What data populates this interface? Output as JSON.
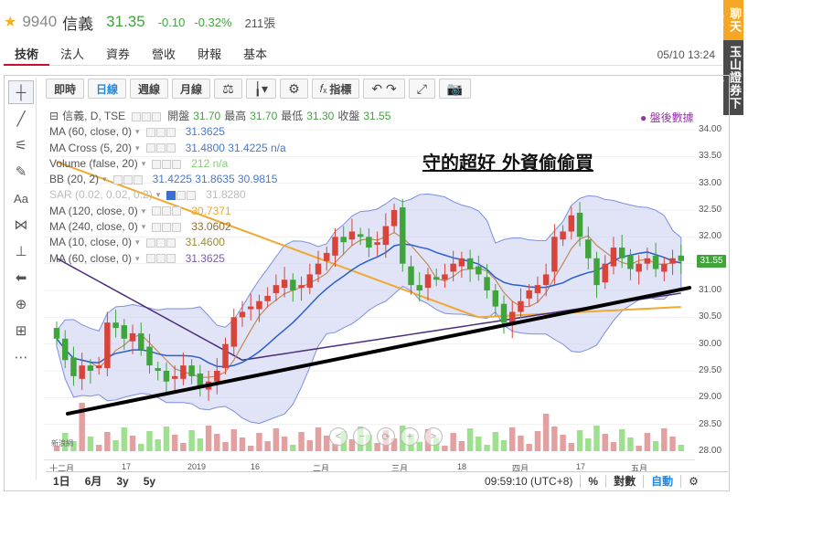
{
  "header": {
    "code": "9940",
    "name": "信義",
    "price": "31.35",
    "change": "-0.10",
    "change_pct": "-0.32%",
    "volume": "211張"
  },
  "tabs": [
    "技術",
    "法人",
    "資券",
    "營收",
    "財報",
    "基本"
  ],
  "active_tab": 0,
  "datetime": "05/10 13:24",
  "side_panel": {
    "chat": "聊天室",
    "broker": "玉山證券下單"
  },
  "toolbar": {
    "buttons": [
      "即時",
      "日線",
      "週線",
      "月線"
    ],
    "active": "日線",
    "indicators_label": "指標"
  },
  "legend": {
    "main": {
      "title": "信義, D, TSE",
      "open_label": "開盤",
      "open": "31.70",
      "high_label": "最高",
      "high": "31.70",
      "low_label": "最低",
      "low": "31.30",
      "close_label": "收盤",
      "close": "31.55"
    },
    "rows": [
      {
        "label": "MA (60, close, 0)",
        "values": "31.3625",
        "color": "#4a78c9"
      },
      {
        "label": "MA Cross (5, 20)",
        "values": "31.4800 31.4225 n/a",
        "color": "#4a78c9"
      },
      {
        "label": "Volume (false, 20)",
        "values": "212 n/a",
        "color": "#7bd36e"
      },
      {
        "label": "BB (20, 2)",
        "values": "31.4225 31.8635 30.9815",
        "color": "#4a78c9"
      },
      {
        "label": "SAR (0.02, 0.02, 0.2)",
        "values": "31.8280",
        "color": "#bbbbbb"
      },
      {
        "label": "MA (120, close, 0)",
        "values": "30.7371",
        "color": "#f0a830"
      },
      {
        "label": "MA (240, close, 0)",
        "values": "33.0602",
        "color": "#8a6d2f"
      },
      {
        "label": "MA (10, close, 0)",
        "values": "31.4600",
        "color": "#9c8a3c"
      },
      {
        "label": "MA (60, close, 0)",
        "values": "31.3625",
        "color": "#7a5aa8"
      }
    ]
  },
  "annotation": "守的超好 外資偷偷買",
  "after_hours_label": "盤後數據",
  "yaxis": {
    "ticks": [
      "34.00",
      "33.50",
      "33.00",
      "32.50",
      "32.00",
      "31.50",
      "31.00",
      "30.50",
      "30.00",
      "29.50",
      "29.00",
      "28.50",
      "28.00"
    ],
    "current_tag": "31.55"
  },
  "xaxis": {
    "ticks": [
      "十二月",
      "17",
      "2019",
      "16",
      "二月",
      "三月",
      "18",
      "四月",
      "17",
      "五月"
    ]
  },
  "bottom": {
    "ranges": [
      "1日",
      "6月",
      "3y",
      "5y"
    ],
    "time": "09:59:10 (UTC+8)",
    "pct": "%",
    "log": "對數",
    "auto": "自動"
  },
  "logo": "新浪網",
  "colors": {
    "up": "#d9443a",
    "down": "#3fa53b",
    "accent": "#1e88e5",
    "bb_fill": "#c9cef0"
  },
  "chart_data": {
    "type": "candlestick",
    "ylim": [
      28.0,
      34.0
    ],
    "close": [
      30.1,
      29.7,
      29.4,
      29.6,
      29.5,
      29.6,
      30.4,
      30.3,
      30.1,
      30.2,
      29.9,
      29.6,
      29.5,
      29.3,
      29.4,
      29.6,
      29.4,
      29.2,
      29.3,
      29.5,
      30.0,
      30.5,
      30.6,
      30.7,
      30.8,
      30.9,
      31.1,
      31.2,
      31.0,
      31.1,
      31.3,
      31.5,
      31.7,
      32.0,
      31.9,
      32.1,
      32.0,
      31.8,
      31.9,
      32.2,
      32.5,
      31.5,
      31.1,
      31.0,
      31.3,
      31.2,
      31.3,
      31.5,
      31.6,
      31.4,
      31.3,
      31.0,
      30.7,
      30.4,
      30.6,
      30.8,
      31.0,
      31.1,
      31.3,
      32.0,
      32.1,
      32.4,
      32.0,
      31.6,
      31.1,
      31.5,
      31.8,
      31.6,
      31.4,
      31.5,
      31.6,
      31.4,
      31.5,
      31.6,
      31.55
    ]
  }
}
